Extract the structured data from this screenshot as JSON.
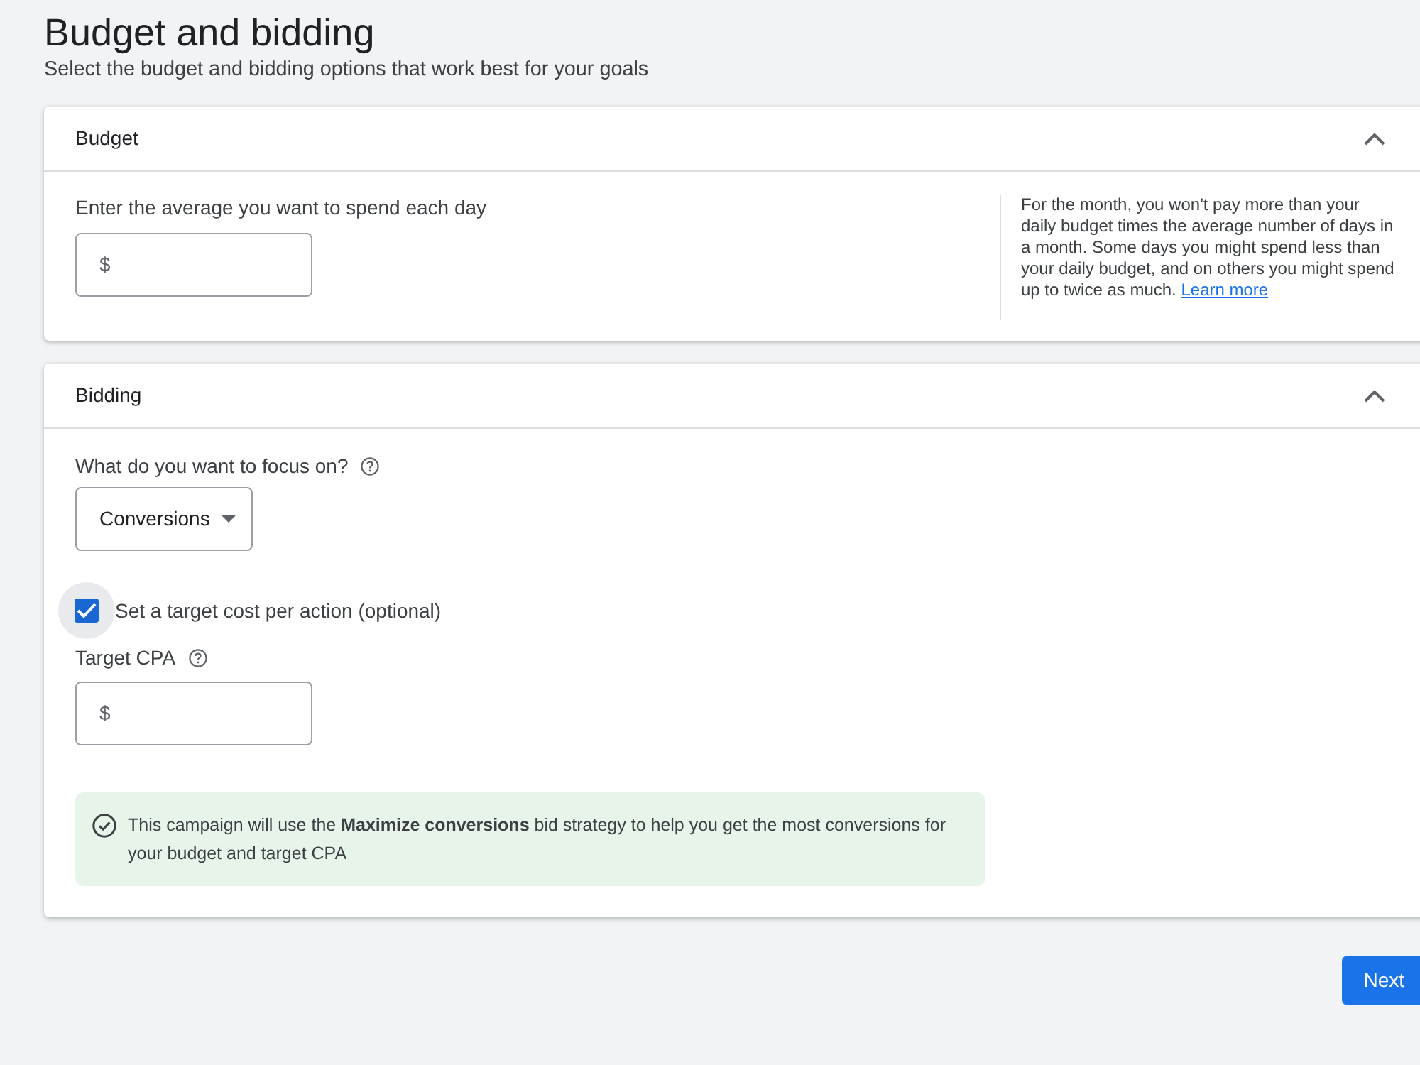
{
  "page": {
    "title": "Budget and bidding",
    "subtitle": "Select the budget and bidding options that work best for your goals"
  },
  "budget": {
    "title": "Budget",
    "expanded": true,
    "label": "Enter the average you want to spend each day",
    "field": {
      "prefix": "$"
    },
    "help": {
      "text": "For the month, you won't pay more than your daily budget times the average number of days in a month. Some days you might spend less than your daily budget, and on others you might spend up to twice as much.",
      "link": "Learn more"
    }
  },
  "bidding": {
    "title": "Bidding",
    "expanded": true,
    "focus": {
      "label": "What do you want to focus on?",
      "value": "Conversions"
    },
    "target_checkbox": {
      "label": "Set a target cost per action (optional)",
      "checked": true
    },
    "target_cpa": {
      "label": "Target CPA",
      "prefix": "$"
    },
    "notice": "This campaign will use the **Maximize conversions** bid strategy to help you get the most conversions for your budget and target CPA"
  },
  "next_button": "Next"
}
